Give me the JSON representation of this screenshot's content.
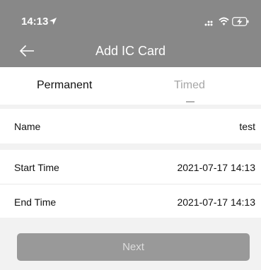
{
  "status_bar": {
    "time": "14:13",
    "icons": [
      "location-arrow-icon",
      "signal-icon",
      "wifi-icon",
      "battery-charging-icon"
    ]
  },
  "header": {
    "title": "Add IC Card",
    "back_icon": "back-arrow-icon"
  },
  "tabs": [
    {
      "label": "Permanent",
      "active": true
    },
    {
      "label": "Timed",
      "active": false
    }
  ],
  "form": {
    "name": {
      "label": "Name",
      "value": "test"
    },
    "start_time": {
      "label": "Start Time",
      "value": "2021-07-17 14:13"
    },
    "end_time": {
      "label": "End Time",
      "value": "2021-07-17 14:13"
    }
  },
  "actions": {
    "next_label": "Next"
  },
  "colors": {
    "header_bg": "#888888",
    "button_bg": "#999999",
    "page_bg": "#f2f2f2"
  }
}
